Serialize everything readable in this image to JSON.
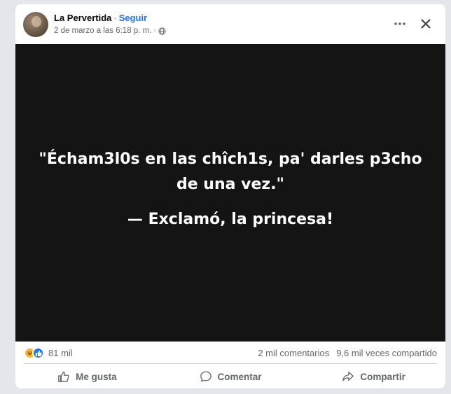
{
  "post": {
    "author": "La Pervertida",
    "separator": "·",
    "follow_label": "Seguir",
    "date": "2 de marzo a las 6:18 p. m.",
    "separator2": "·",
    "audience_icon": "globe-icon",
    "image_text": {
      "quote": "\"Écham3l0s en las chîch1s, pa' darles p3cho de una vez.\"",
      "attribution": "— Exclamó, la princesa!"
    },
    "reactions": {
      "icons": [
        "haha-icon",
        "like-icon"
      ],
      "count": "81 mil"
    },
    "comments": "2 mil comentarios",
    "shares": "9,6 mil veces compartido",
    "actions": {
      "like": "Me gusta",
      "comment": "Comentar",
      "share": "Compartir"
    }
  },
  "colors": {
    "page_bg": "#e4e6eb",
    "card_bg": "#ffffff",
    "accent": "#1877f2",
    "secondary_text": "#65676b",
    "image_bg": "#141414"
  }
}
